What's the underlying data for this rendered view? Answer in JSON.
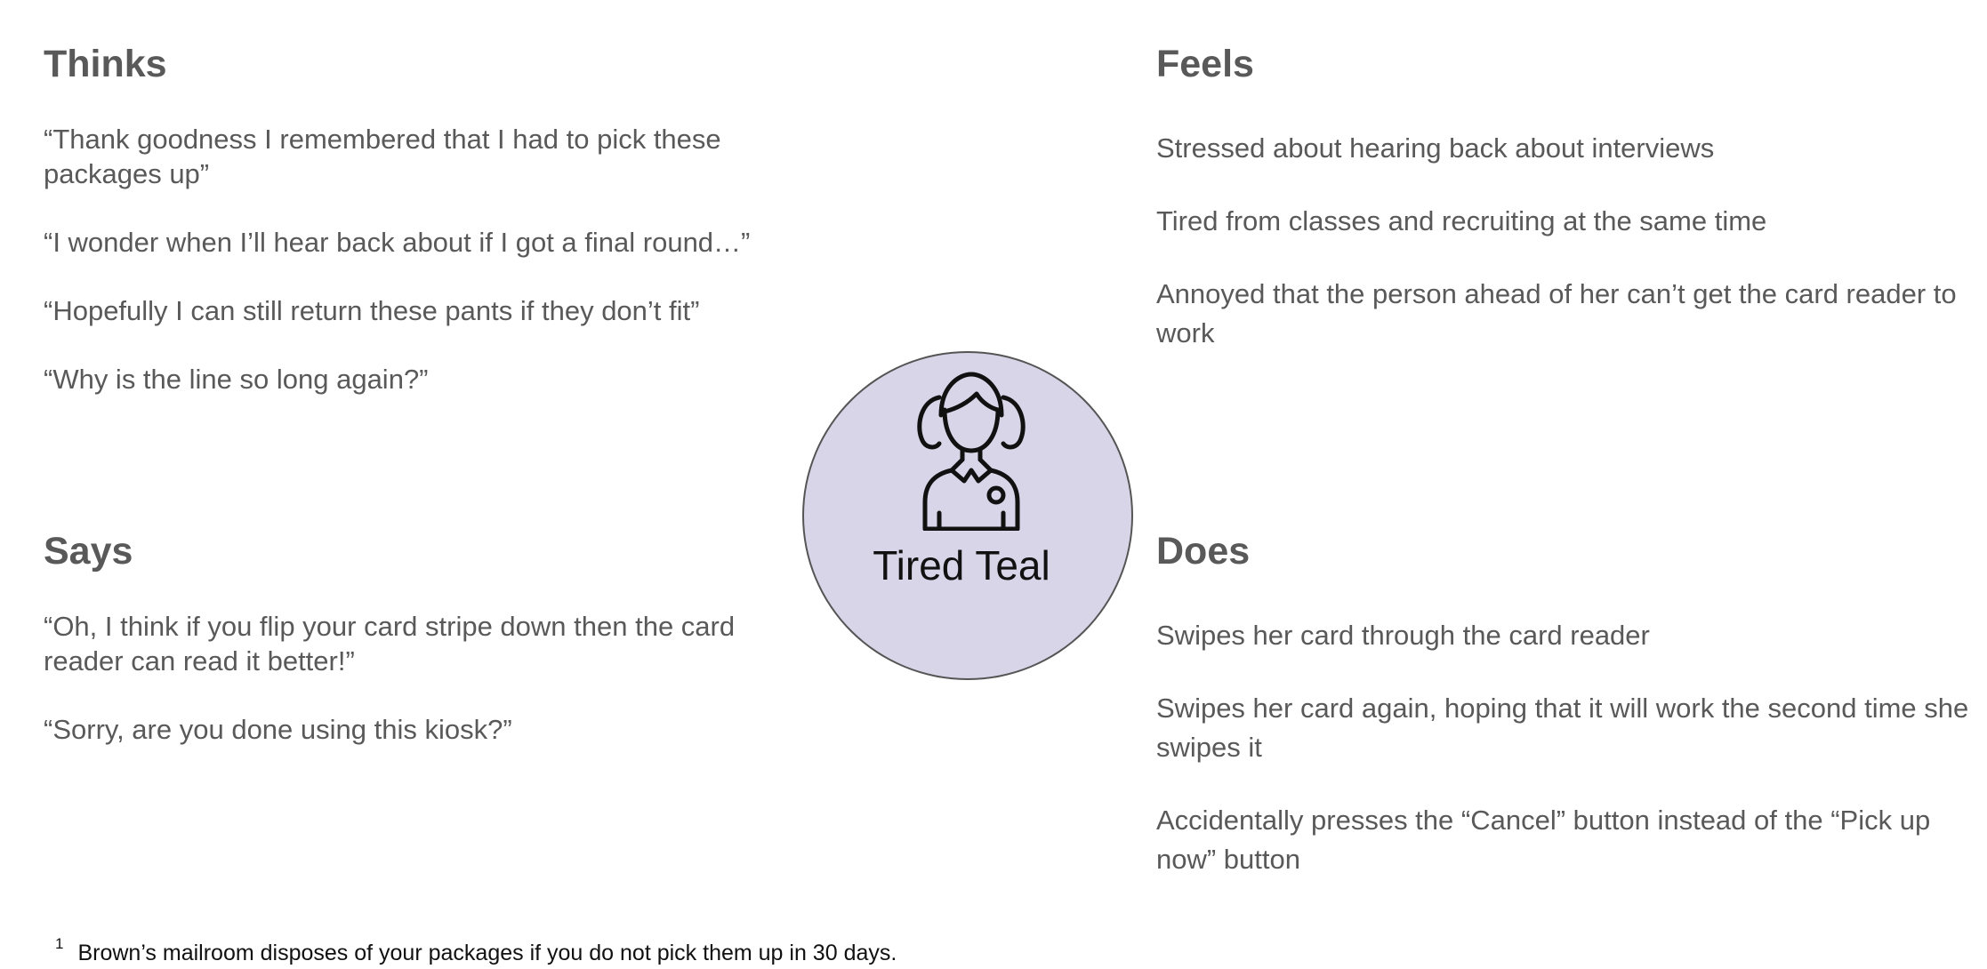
{
  "thinks": {
    "title": "Thinks",
    "items": [
      "“Thank goodness I remembered that I had to pick these packages up”",
      "“I wonder when I’ll hear back about if I got a final round…”",
      "“Hopefully I can still return these pants if they don’t fit”",
      "“Why is the line so long again?”"
    ]
  },
  "feels": {
    "title": "Feels",
    "items": [
      "Stressed about hearing back about interviews",
      "Tired from classes and recruiting at the same time",
      "Annoyed that the person ahead of her can’t get the card reader to work"
    ]
  },
  "says": {
    "title": "Says",
    "items": [
      "“Oh, I think if you flip your card stripe down then the card reader can read it better!”",
      "“Sorry, are you done using this kiosk?”"
    ]
  },
  "does": {
    "title": "Does",
    "items": [
      "Swipes her card through the card reader",
      "Swipes her card again, hoping that it will work the second time she swipes it",
      "Accidentally presses the “Cancel” button instead of the “Pick up now” button"
    ]
  },
  "persona": {
    "name": "Tired Teal",
    "icon": "student-avatar-icon",
    "circle_color": "#d9d5e8"
  },
  "footnote": {
    "marker": "1",
    "text": "Brown’s mailroom disposes of your packages if you do not pick them up in 30 days."
  }
}
